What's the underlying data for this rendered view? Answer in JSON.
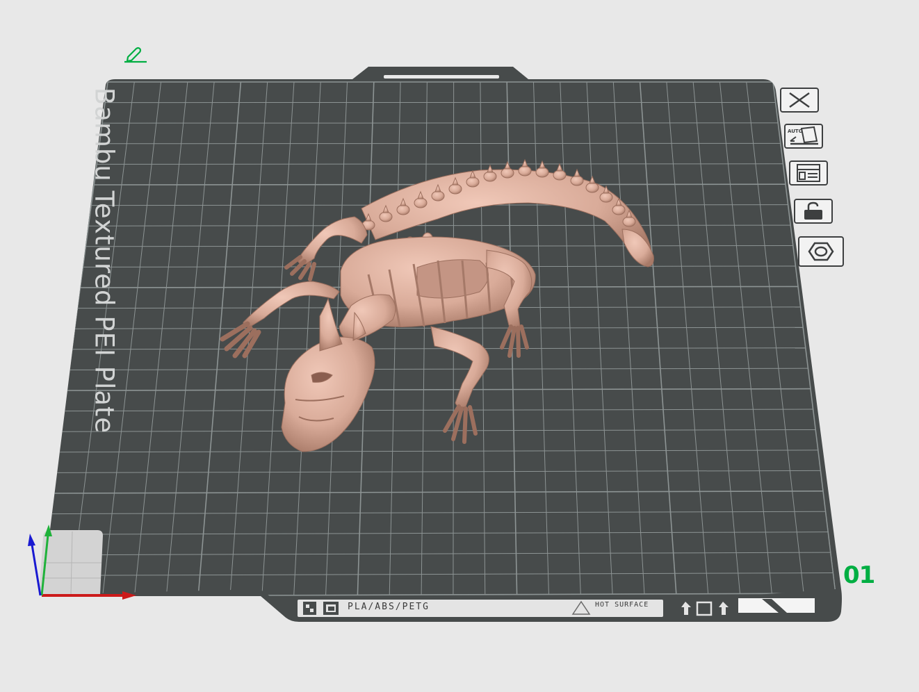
{
  "plate": {
    "bed_label": "Bambu Textured PEI Plate",
    "plate_number": "01",
    "filament_types": "PLA/ABS/PETG",
    "warning": "HOT SURFACE"
  },
  "toolbar": {
    "delete_label": "Delete plate",
    "auto_label": "AUTO",
    "arrange_label": "Arrange",
    "lock_label": "Lock plate",
    "settings_label": "Plate settings"
  },
  "model": {
    "name": "dragon-skeleton"
  },
  "colors": {
    "background": "#e8e8e8",
    "bed": "#474b4b",
    "grid": "#8d9494",
    "model": "#d9ab99",
    "accent": "#00ae42",
    "axis_x": "#cc1a1a",
    "axis_y": "#1fb23a",
    "axis_z": "#1a1ad1"
  }
}
